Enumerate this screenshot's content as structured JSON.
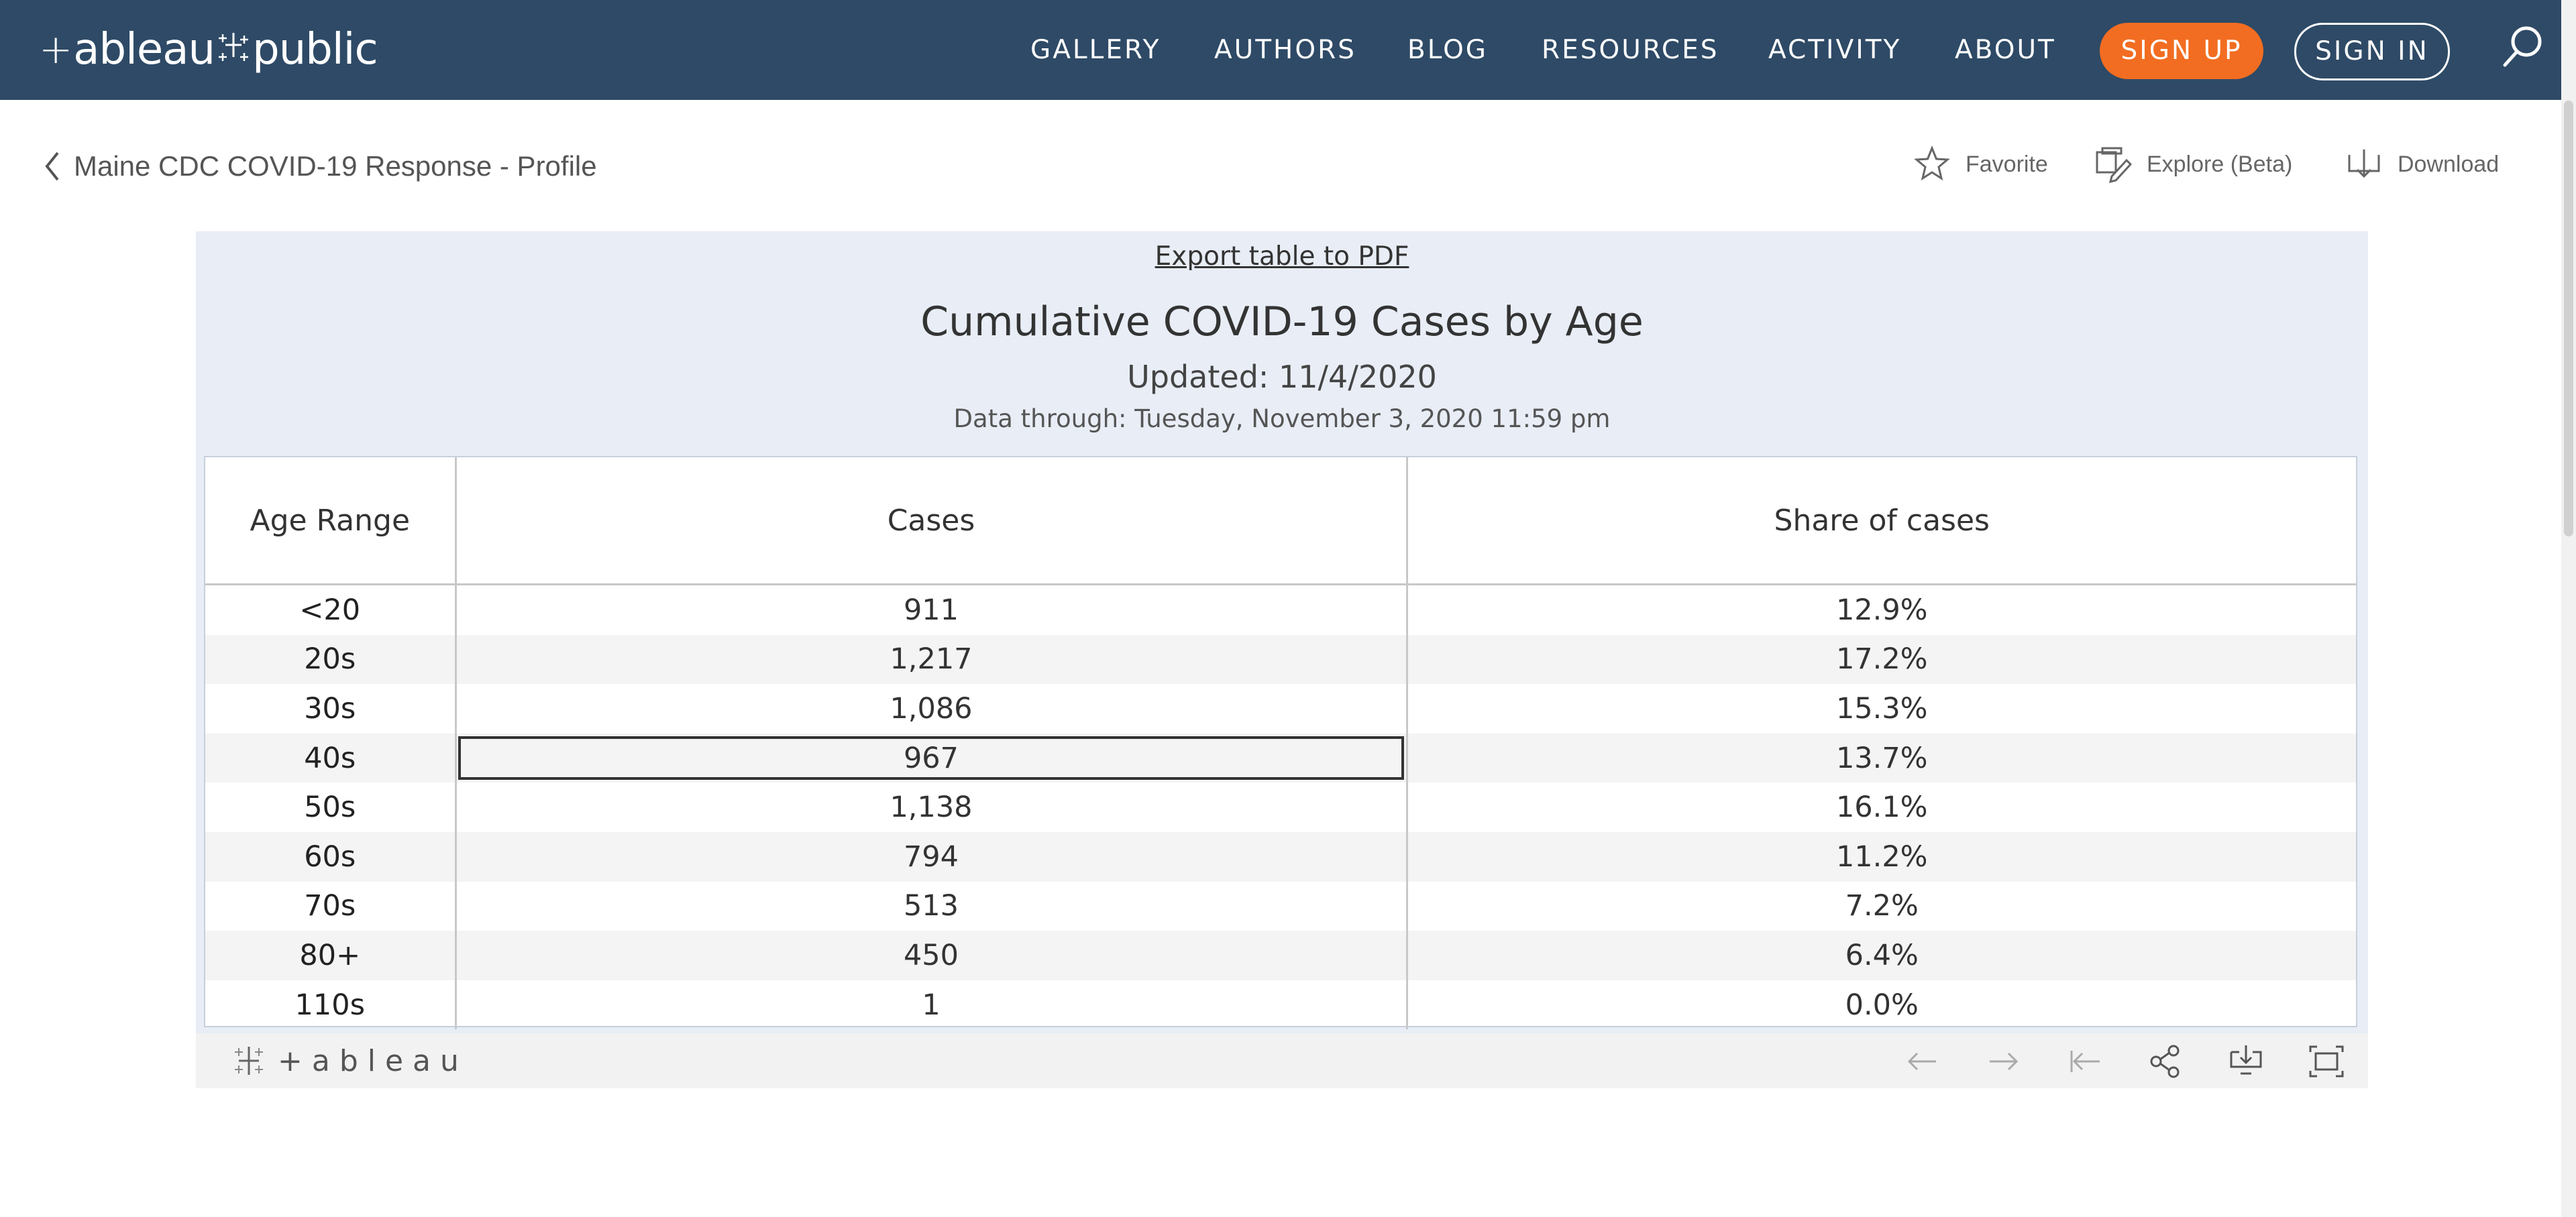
{
  "header": {
    "logo_text": "public",
    "logo_prefix": "+ableau",
    "nav": [
      "GALLERY",
      "AUTHORS",
      "BLOG",
      "RESOURCES",
      "ACTIVITY",
      "ABOUT"
    ],
    "signup_label": "SIGN UP",
    "signin_label": "SIGN IN",
    "search_icon": "search-icon"
  },
  "profile": {
    "back_label": "Maine CDC COVID-19 Response - Profile",
    "actions": {
      "favorite": "Favorite",
      "explore": "Explore (Beta)",
      "download": "Download"
    }
  },
  "viz": {
    "export_label": "Export table to PDF",
    "title": "Cumulative COVID-19 Cases by Age",
    "updated": "Updated: 11/4/2020",
    "data_through": "Data through: Tuesday, November 3, 2020 11:59 pm",
    "columns": [
      "Age Range",
      "Cases",
      "Share of cases"
    ],
    "rows": [
      {
        "age": "<20",
        "cases": "911",
        "share": "12.9%"
      },
      {
        "age": "20s",
        "cases": "1,217",
        "share": "17.2%"
      },
      {
        "age": "30s",
        "cases": "1,086",
        "share": "15.3%"
      },
      {
        "age": "40s",
        "cases": "967",
        "share": "13.7%"
      },
      {
        "age": "50s",
        "cases": "1,138",
        "share": "16.1%"
      },
      {
        "age": "60s",
        "cases": "794",
        "share": "11.2%"
      },
      {
        "age": "70s",
        "cases": "513",
        "share": "7.2%"
      },
      {
        "age": "80+",
        "cases": "450",
        "share": "6.4%"
      },
      {
        "age": "110s",
        "cases": "1",
        "share": "0.0%"
      }
    ],
    "selected_row": 3,
    "footer_logo": "+ableau"
  },
  "colors": {
    "nav_bg": "#2e4a66",
    "signup_bg": "#f26d21",
    "viz_bg": "#e8edf6"
  }
}
